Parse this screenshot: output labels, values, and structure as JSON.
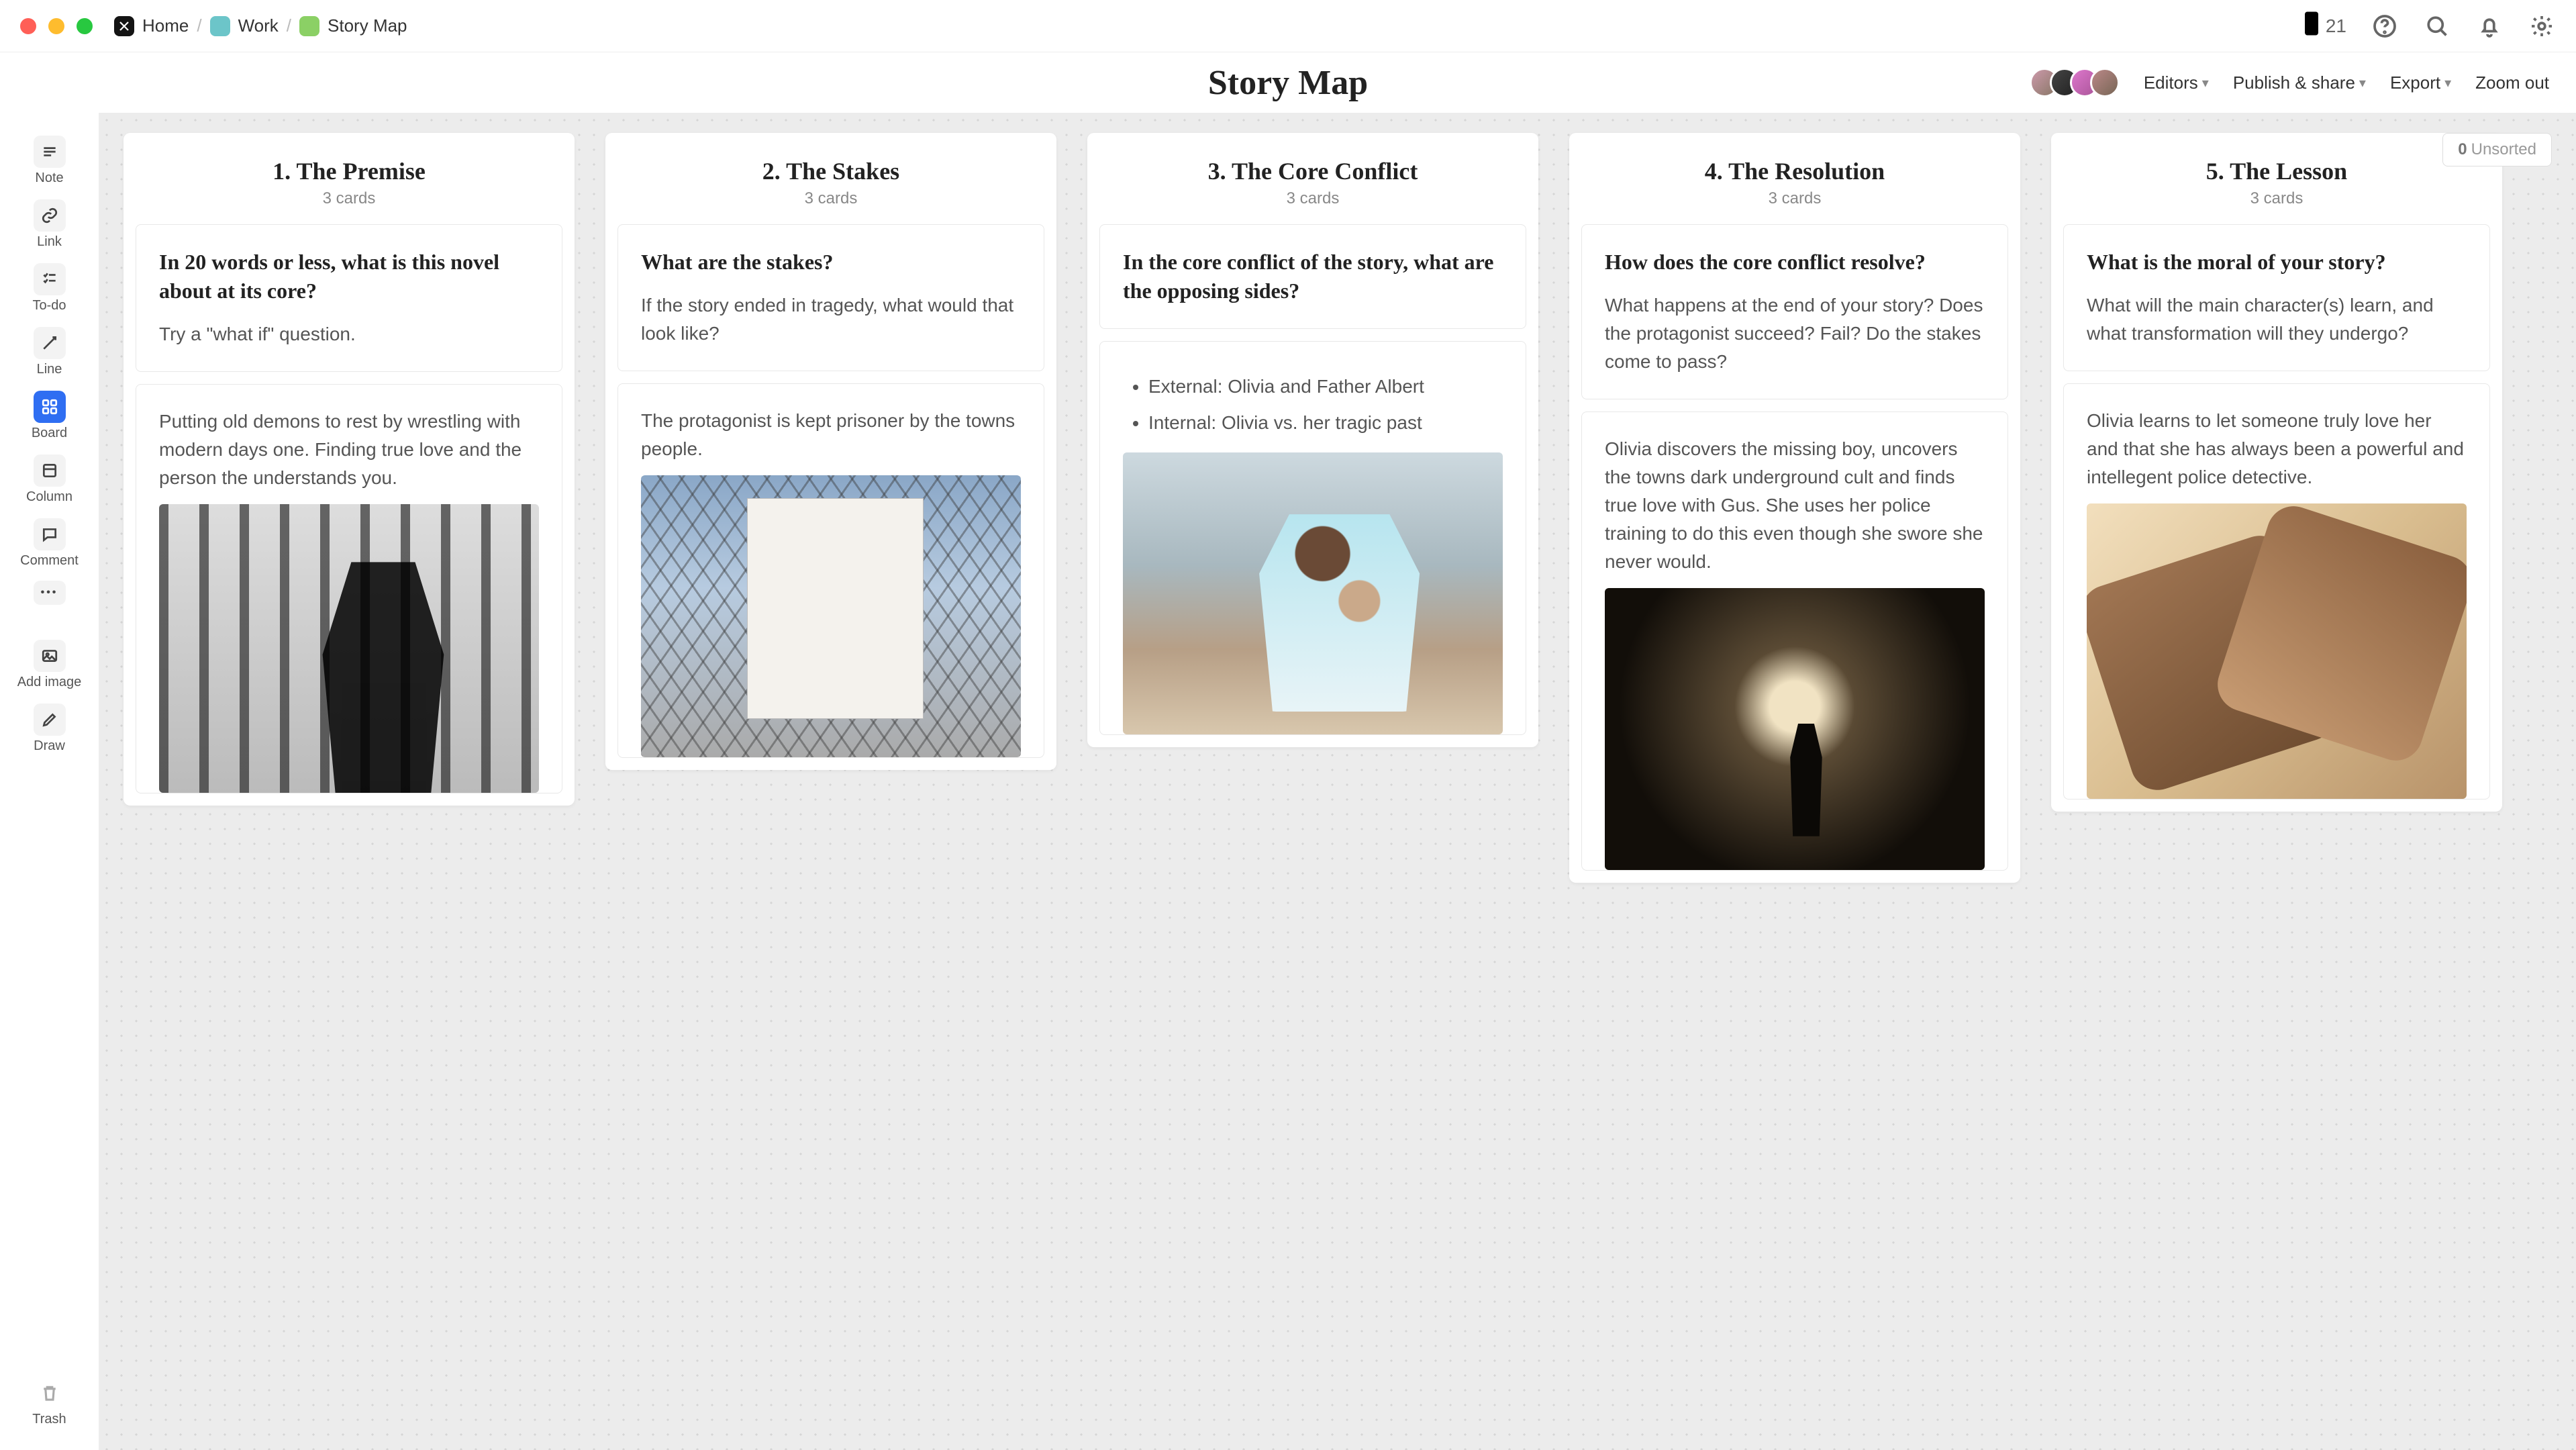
{
  "breadcrumbs": {
    "home": "Home",
    "work": "Work",
    "page": "Story Map"
  },
  "titlebar": {
    "count": "21"
  },
  "header": {
    "title": "Story Map",
    "buttons": {
      "editors": "Editors",
      "publish": "Publish & share",
      "export": "Export",
      "zoom": "Zoom out"
    }
  },
  "unsorted": {
    "count": "0",
    "label": "Unsorted"
  },
  "sidebar": {
    "items": [
      {
        "id": "note",
        "label": "Note"
      },
      {
        "id": "link",
        "label": "Link"
      },
      {
        "id": "todo",
        "label": "To-do"
      },
      {
        "id": "line",
        "label": "Line"
      },
      {
        "id": "board",
        "label": "Board"
      },
      {
        "id": "column",
        "label": "Column"
      },
      {
        "id": "comment",
        "label": "Comment"
      }
    ],
    "addimage": "Add image",
    "draw": "Draw",
    "trash": "Trash"
  },
  "columns": [
    {
      "title": "1. The Premise",
      "count": "3 cards",
      "q_title": "In 20 words or less, what is this novel about at its core?",
      "q_body": "Try a \"what if\" question.",
      "body": "Putting old demons to rest by wrestling with modern days one. Finding true love and the person the understands you."
    },
    {
      "title": "2. The Stakes",
      "count": "3 cards",
      "q_title": "What are the stakes?",
      "q_body": "If the story ended in tragedy, what would that look like?",
      "body": "The protagonist is kept prisoner by the towns people."
    },
    {
      "title": "3. The Core Conflict",
      "count": "3 cards",
      "q_title": "In the core conflict of the story, what are the opposing sides?",
      "bullets": [
        "External: Olivia and Father Albert",
        "Internal: Olivia vs. her tragic past"
      ]
    },
    {
      "title": "4. The Resolution",
      "count": "3 cards",
      "q_title": "How does the core conflict resolve?",
      "q_body": "What happens at the end of your story? Does the protagonist succeed? Fail? Do the stakes come to pass?",
      "body": "Olivia discovers the missing boy, uncovers the towns dark underground cult and finds true love with Gus. She uses her police training to do this even though she swore she never would."
    },
    {
      "title": "5. The Lesson",
      "count": "3 cards",
      "q_title": "What is the moral of your story?",
      "q_body": "What will the main character(s) learn, and what transformation will they undergo?",
      "body": "Olivia learns to let someone truly love her and that she has always been a powerful and intellegent police detective."
    }
  ]
}
